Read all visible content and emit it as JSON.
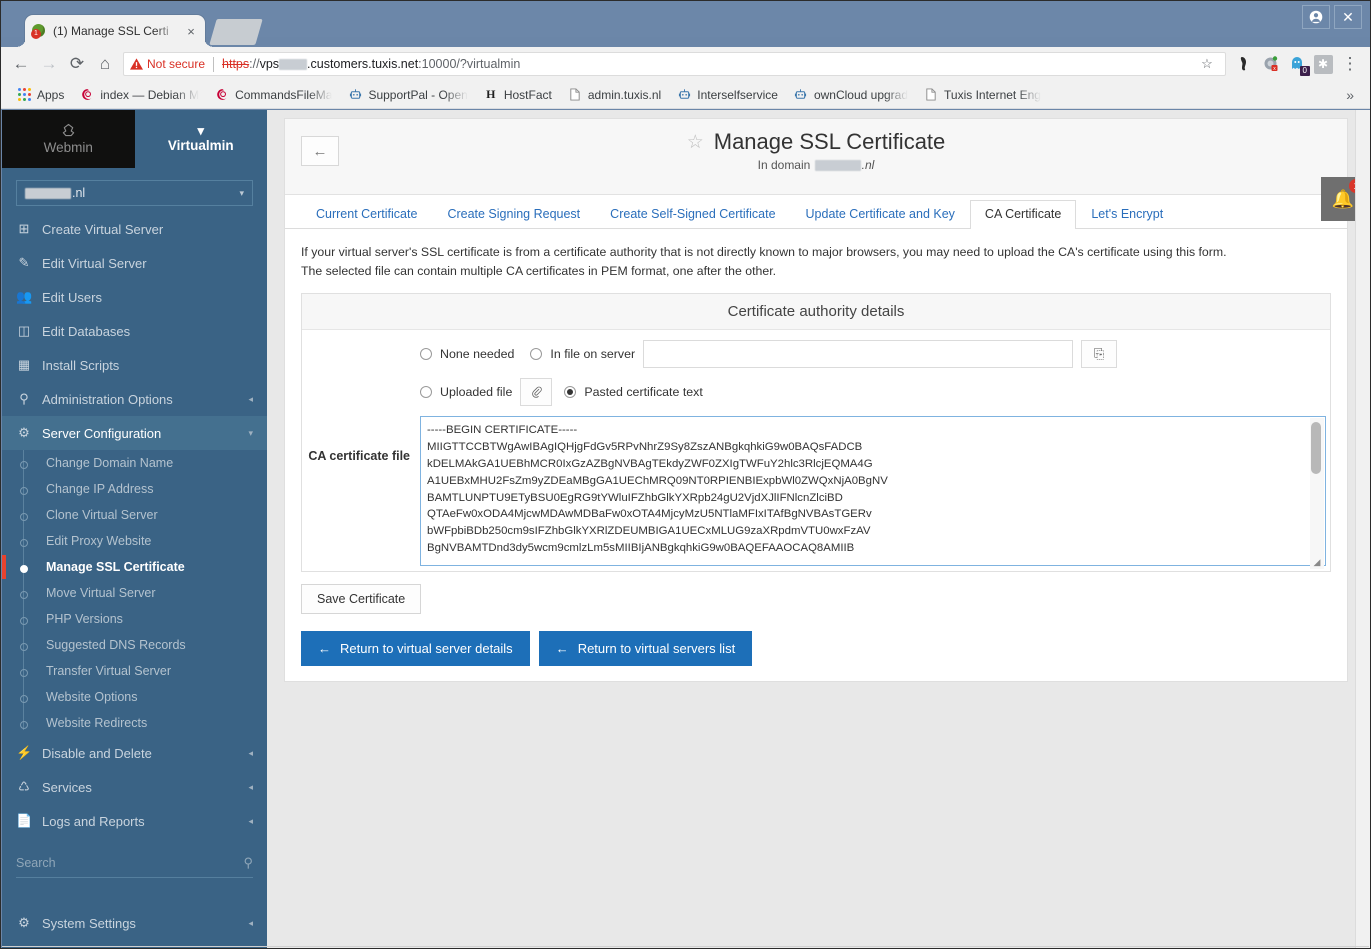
{
  "browser": {
    "tab": {
      "title": "(1) Manage SSL Certi",
      "close_label": "×",
      "favicon_badge": "1"
    },
    "toolbar": {
      "back_label": "←",
      "forward_label": "→",
      "reload_label": "⟳",
      "home_label": "⌂",
      "security_label": "Not secure",
      "url_scheme": "https",
      "url_sep": "://",
      "url_host_prefix": "vps",
      "url_host_suffix": ".customers.tuxis.net",
      "url_port": ":10000",
      "url_path": "/?virtualmin",
      "star_label": "☆",
      "menu_label": "⋮",
      "extension_badge": "0"
    },
    "bookmarks": {
      "apps_label": "Apps",
      "overflow_label": "»",
      "items": [
        {
          "label": "index — Debian M",
          "icon": "debian-icon"
        },
        {
          "label": "CommandsFileMa",
          "icon": "debian-icon"
        },
        {
          "label": "SupportPal - Open",
          "icon": "robot-icon"
        },
        {
          "label": "HostFact",
          "icon": "hostfact-icon"
        },
        {
          "label": "admin.tuxis.nl",
          "icon": "page-icon"
        },
        {
          "label": "Interselfservice",
          "icon": "robot-icon"
        },
        {
          "label": "ownCloud upgrad",
          "icon": "robot-icon"
        },
        {
          "label": "Tuxis Internet Eng",
          "icon": "page-icon"
        }
      ]
    },
    "window": {
      "account_label": "●",
      "close_label": "✕"
    }
  },
  "sidebar": {
    "brand_webmin": "Webmin",
    "brand_virtualmin": "Virtualmin",
    "domain_selector": {
      "value": ".nl",
      "caret": "▾"
    },
    "items": [
      {
        "label": "Create Virtual Server",
        "icon": "plus-square-icon",
        "chevron": ""
      },
      {
        "label": "Edit Virtual Server",
        "icon": "edit-square-icon",
        "chevron": ""
      },
      {
        "label": "Edit Users",
        "icon": "users-icon",
        "chevron": ""
      },
      {
        "label": "Edit Databases",
        "icon": "database-icon",
        "chevron": ""
      },
      {
        "label": "Install Scripts",
        "icon": "window-icon",
        "chevron": ""
      },
      {
        "label": "Administration Options",
        "icon": "wrench-icon",
        "chevron": "◂"
      },
      {
        "label": "Server Configuration",
        "icon": "gears-icon",
        "chevron": "▾"
      }
    ],
    "server_config_children": [
      {
        "label": "Change Domain Name",
        "current": false
      },
      {
        "label": "Change IP Address",
        "current": false
      },
      {
        "label": "Clone Virtual Server",
        "current": false
      },
      {
        "label": "Edit Proxy Website",
        "current": false
      },
      {
        "label": "Manage SSL Certificate",
        "current": true
      },
      {
        "label": "Move Virtual Server",
        "current": false
      },
      {
        "label": "PHP Versions",
        "current": false
      },
      {
        "label": "Suggested DNS Records",
        "current": false
      },
      {
        "label": "Transfer Virtual Server",
        "current": false
      },
      {
        "label": "Website Options",
        "current": false
      },
      {
        "label": "Website Redirects",
        "current": false
      }
    ],
    "items_after": [
      {
        "label": "Disable and Delete",
        "icon": "plug-icon",
        "chevron": "◂"
      },
      {
        "label": "Services",
        "icon": "puzzle-icon",
        "chevron": "◂"
      },
      {
        "label": "Logs and Reports",
        "icon": "file-text-icon",
        "chevron": "◂"
      }
    ],
    "search_placeholder": "Search",
    "system_settings": {
      "label": "System Settings",
      "icon": "gear-icon",
      "chevron": "◂"
    }
  },
  "page": {
    "back_arrow": "←",
    "star": "☆",
    "title": "Manage SSL Certificate",
    "subtitle_prefix": "In domain",
    "subtitle_domain": ".nl",
    "notification_count": "1",
    "tabs": [
      {
        "label": "Current Certificate",
        "active": false
      },
      {
        "label": "Create Signing Request",
        "active": false
      },
      {
        "label": "Create Self-Signed Certificate",
        "active": false
      },
      {
        "label": "Update Certificate and Key",
        "active": false
      },
      {
        "label": "CA Certificate",
        "active": true
      },
      {
        "label": "Let's Encrypt",
        "active": false
      }
    ],
    "intro_line1": "If your virtual server's SSL certificate is from a certificate authority that is not directly known to major browsers, you may need to upload the CA's certificate using this form.",
    "intro_line2": "The selected file can contain multiple CA certificates in PEM format, one after the other.",
    "fieldset_legend": "Certificate authority details",
    "field_label": "CA certificate file",
    "options": {
      "none_needed": "None needed",
      "in_file_on_server": "In file on server",
      "uploaded_file": "Uploaded file",
      "pasted_certificate_text": "Pasted certificate text",
      "selected": "pasted_certificate_text"
    },
    "server_file_value": "",
    "clipboard_icon": "⎘",
    "attach_icon": "ॐ",
    "certificate_text": "-----BEGIN CERTIFICATE-----\nMIIGTTCCBTWgAwIBAgIQHjgFdGv5RPvNhrZ9Sy8ZszANBgkqhkiG9w0BAQsFADCB\nkDELMAkGA1UEBhMCR0IxGzAZBgNVBAgTEkdyZWF0ZXIgTWFuY2hlc3RlcjEQMA4G\nA1UEBxMHU2FsZm9yZDEaMBgGA1UEChMRQ09NT0RPIENBIExpbWl0ZWQxNjA0BgNV\nBAMTLUNPTU9ETyBSU0EgRG9tYWluIFZhbGlkYXRpb24gU2VjdXJlIFNlcnZlciBD\nQTAeFw0xODA4MjcwMDAwMDBaFw0xOTA4MjcyMzU5NTlaMFIxITAfBgNVBAsTGERv\nbWFpbiBDb250cm9sIFZhbGlkYXRlZDEUMBIGA1UECxMLUG9zaXRpdmVTU0wxFzAV\nBgNVBAMTDnd3dy5wcm9cmlzLm5sMIIBIjANBgkqhkiG9w0BAQEFAAOCAQ8AMIIB",
    "save_label": "Save Certificate",
    "return_details": {
      "arrow": "←",
      "label": "Return to virtual server details"
    },
    "return_list": {
      "arrow": "←",
      "label": "Return to virtual servers list"
    }
  },
  "colors": {
    "sidebar_bg": "#3a6385",
    "accent_blue": "#1d6fb8",
    "link_blue": "#2a6ebb",
    "danger_red": "#d93025",
    "active_marker": "#e8432f"
  }
}
